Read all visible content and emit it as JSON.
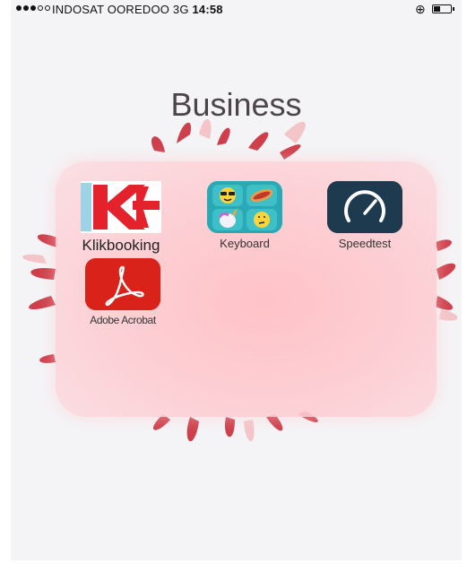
{
  "status_bar": {
    "carrier": "INDOSAT OOREDOO",
    "network": "3G",
    "time": "14:58",
    "signal_bars_filled": 3,
    "signal_bars_total": 5,
    "battery_level": 0.4,
    "lock_icon": "orientation-lock-icon"
  },
  "folder": {
    "title": "Business",
    "apps": [
      {
        "label": "Klikbooking",
        "icon": "klikbooking-icon"
      },
      {
        "label": "Keyboard",
        "icon": "emoji-keyboard-icon"
      },
      {
        "label": "Speedtest",
        "icon": "speedometer-icon"
      },
      {
        "label": "Adobe Acrobat",
        "icon": "acrobat-icon"
      }
    ]
  },
  "colors": {
    "screen_bg": "#f4f4f6",
    "folder_bg": "#fcc8cd",
    "klik_red": "#e3222b",
    "acrobat_red": "#d9231a",
    "speedtest_bg": "#1d3a4e",
    "keyboard_bg": "#29a8b5"
  }
}
